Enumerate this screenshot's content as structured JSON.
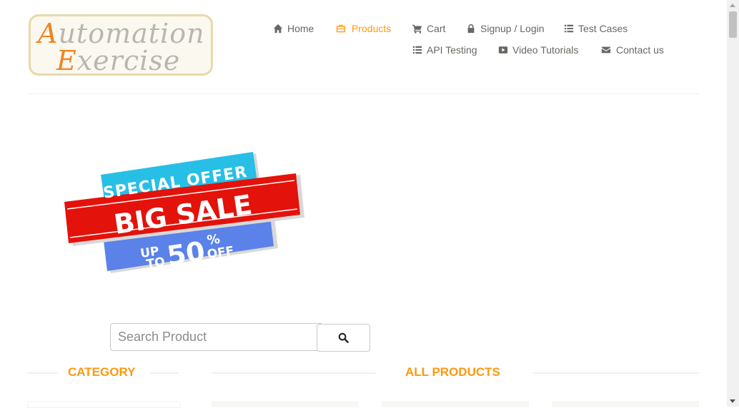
{
  "logo": {
    "line1_cap": "A",
    "line1_rest": "utomation",
    "line2_cap": "E",
    "line2_rest": "xercise"
  },
  "nav": {
    "home": "Home",
    "products": "Products",
    "cart": "Cart",
    "signup_login": "Signup / Login",
    "test_cases": "Test Cases",
    "api_testing": "API Testing",
    "video_tutorials": "Video Tutorials",
    "contact_us": "Contact us",
    "active_item": "products"
  },
  "banner": {
    "special_offer": "SPECIAL OFFER",
    "big_sale": "BIG SALE",
    "up": "UP",
    "to": "TO",
    "fifty": "50",
    "percent": "%",
    "off": "OFF"
  },
  "search": {
    "placeholder": "Search Product",
    "button_icon": "search-icon"
  },
  "sections": {
    "category": "CATEGORY",
    "all_products": "ALL PRODUCTS"
  },
  "colors": {
    "accent": "#fe980f",
    "nav_text": "#696763",
    "banner_cyan": "#27bfe6",
    "banner_red": "#e3120b",
    "banner_blue": "#5a82e8"
  }
}
